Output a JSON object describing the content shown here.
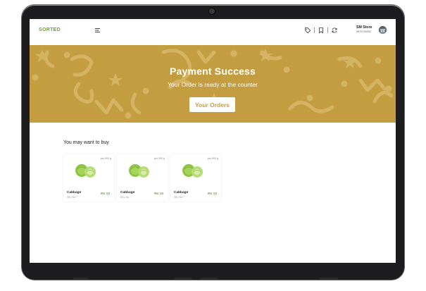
{
  "header": {
    "logo": "SORTED",
    "icons": [
      "menu-icon",
      "tag-icon",
      "bookmark-icon",
      "refresh-icon"
    ],
    "store_name": "SM Store",
    "store_phone": "9876746392"
  },
  "banner": {
    "title": "Payment Success",
    "subtitle": "Your Order is ready at the counter",
    "button_label": "Your Orders",
    "background_color": "#c49d41"
  },
  "recommendations": {
    "title": "You may want to buy",
    "items": [
      {
        "weight": "per 500 g",
        "name": "Cabbage",
        "sku": "SKU No.",
        "price": "Rs 10"
      },
      {
        "weight": "per 500 g",
        "name": "Cabbage",
        "sku": "SKU No.",
        "price": "Rs 10"
      },
      {
        "weight": "per 500 g",
        "name": "Cabbage",
        "sku": "SKU No.",
        "price": "Rs 10"
      }
    ]
  },
  "colors": {
    "brand_green": "#6aa43a",
    "banner_gold": "#c49d41"
  }
}
